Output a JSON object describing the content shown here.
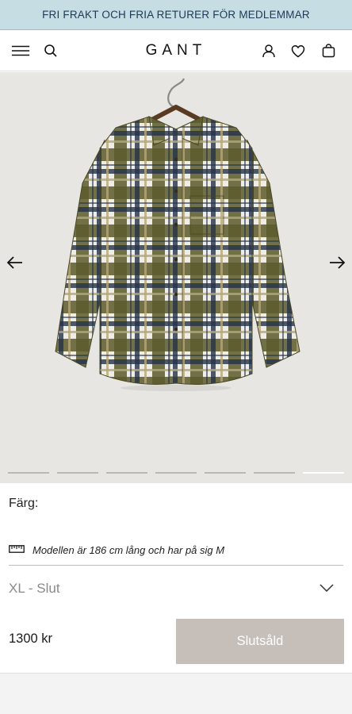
{
  "promo_banner": {
    "text": "FRI FRAKT OCH FRIA RETURER FÖR MEDLEMMAR"
  },
  "header": {
    "brand": "GANT",
    "icons": [
      "menu-icon",
      "search-icon",
      "account-icon",
      "heart-icon",
      "bag-icon"
    ]
  },
  "gallery": {
    "image_count": 7,
    "active_index": 6,
    "shirt_colors": {
      "olive": "#5c5a2b",
      "cream": "#efeee6",
      "navy": "#23324a",
      "tan": "#b5a67a"
    },
    "background": "#e7e6e2"
  },
  "product": {
    "color_label": "Färg:",
    "model_info": "Modellen är 186 cm lång och har på sig M",
    "size_selector": "XL - Slut",
    "price": "1300 kr",
    "button_label": "Slutsåld"
  },
  "colors": {
    "promo_bg": "#c5dde3",
    "promo_text": "#1d3a56",
    "button_bg": "#c6bfb9"
  }
}
